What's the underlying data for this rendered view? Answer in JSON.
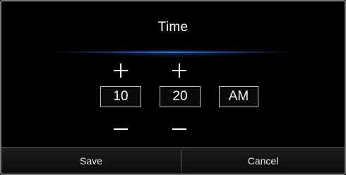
{
  "dialog": {
    "title": "Time"
  },
  "time": {
    "hour": "10",
    "minute": "20",
    "period": "AM"
  },
  "buttons": {
    "save_label": "Save",
    "cancel_label": "Cancel"
  },
  "icons": {
    "increase": "plus-icon",
    "decrease": "minus-icon"
  },
  "colors": {
    "background": "#000000",
    "text": "#ffffff",
    "accent_glow": "#2f74e0",
    "box_border": "#bfbfbf"
  }
}
